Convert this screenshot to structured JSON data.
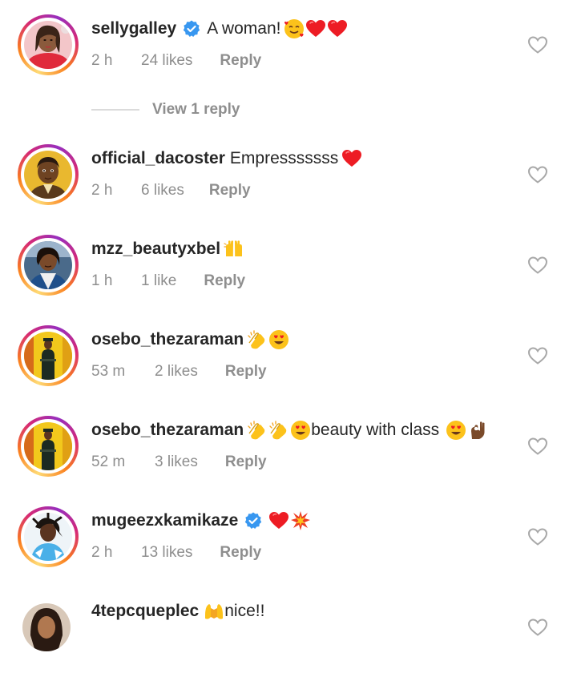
{
  "comments": [
    {
      "username": "sellygalley",
      "verified": true,
      "text": "A woman!",
      "emojis": [
        "smiling-face-with-hearts",
        "red-heart",
        "red-heart"
      ],
      "time": "2 h",
      "likes": "24 likes",
      "reply": "Reply",
      "view_replies": "View 1 reply"
    },
    {
      "username": "official_dacoster",
      "verified": false,
      "text": "Empresssssss",
      "emojis": [
        "red-heart"
      ],
      "time": "2 h",
      "likes": "6 likes",
      "reply": "Reply"
    },
    {
      "username": "mzz_beautyxbel",
      "verified": false,
      "text": "",
      "emojis": [
        "raising-hands"
      ],
      "time": "1 h",
      "likes": "1 like",
      "reply": "Reply"
    },
    {
      "username": "osebo_thezaraman",
      "verified": false,
      "text": "",
      "emojis": [
        "clapping-hands",
        "heart-eyes"
      ],
      "time": "53 m",
      "likes": "2 likes",
      "reply": "Reply"
    },
    {
      "username": "osebo_thezaraman",
      "verified": false,
      "text": "beauty with class",
      "emojis_before": [
        "clapping-hands",
        "clapping-hands",
        "heart-eyes"
      ],
      "emojis": [
        "heart-eyes",
        "ok-hand"
      ],
      "time": "52 m",
      "likes": "3 likes",
      "reply": "Reply"
    },
    {
      "username": "mugeezxkamikaze",
      "verified": true,
      "text": "",
      "emojis": [
        "red-heart",
        "collision"
      ],
      "time": "2 h",
      "likes": "13 likes",
      "reply": "Reply"
    },
    {
      "username": "4tepcqueplec",
      "verified": false,
      "text": "nice!!",
      "emojis_before": [
        "palms-up-together"
      ],
      "time": "",
      "likes": "",
      "reply": ""
    }
  ],
  "icons": {
    "like": "heart-outline-icon",
    "verified": "verified-badge-icon"
  },
  "colors": {
    "text": "#262626",
    "meta": "#8e8e8e",
    "verified": "#3897f0",
    "heart": "#ed1c24"
  }
}
